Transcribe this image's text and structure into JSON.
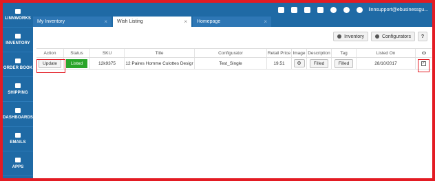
{
  "sidebar": {
    "items": [
      {
        "label": "LINNWORKS",
        "icon": "linnworks-logo-icon"
      },
      {
        "label": "INVENTORY",
        "icon": "inventory-icon"
      },
      {
        "label": "ORDER BOOK",
        "icon": "order-book-icon"
      },
      {
        "label": "SHIPPING",
        "icon": "truck-icon"
      },
      {
        "label": "DASHBOARDS",
        "icon": "bar-chart-icon"
      },
      {
        "label": "EMAILS",
        "icon": "envelope-icon"
      },
      {
        "label": "APPS",
        "icon": "puzzle-icon"
      }
    ]
  },
  "topbar": {
    "user": "linnsupport@ebusinessgu..."
  },
  "tabs": [
    {
      "label": "My Inventory",
      "close": "×"
    },
    {
      "label": "Wish Listing",
      "close": "×",
      "active": true
    },
    {
      "label": "Homepage",
      "close": "×"
    }
  ],
  "toolbar": {
    "inventory": "Inventory",
    "configurators": "Configurators",
    "help": "?"
  },
  "table": {
    "headers": [
      "Action",
      "Status",
      "SKU",
      "Title",
      "Configurator",
      "Retail Price",
      "Image",
      "Description",
      "Tag",
      "Listed On"
    ],
    "rows": [
      {
        "action": "Update",
        "status": "Listed",
        "sku": "12k9375",
        "title": "12 Paires Homme Culottes Desigr",
        "configurator": "Test_Single",
        "retail_price": "19.51",
        "image_icon": "gear-icon",
        "description": "Filled",
        "tag": "Filled",
        "listed_on": "28/10/2017",
        "checked": "✓"
      }
    ]
  },
  "colors": {
    "brand_blue": "#1f6aa5",
    "listed_green": "#2aa52a",
    "highlight_red": "#e31b23"
  }
}
